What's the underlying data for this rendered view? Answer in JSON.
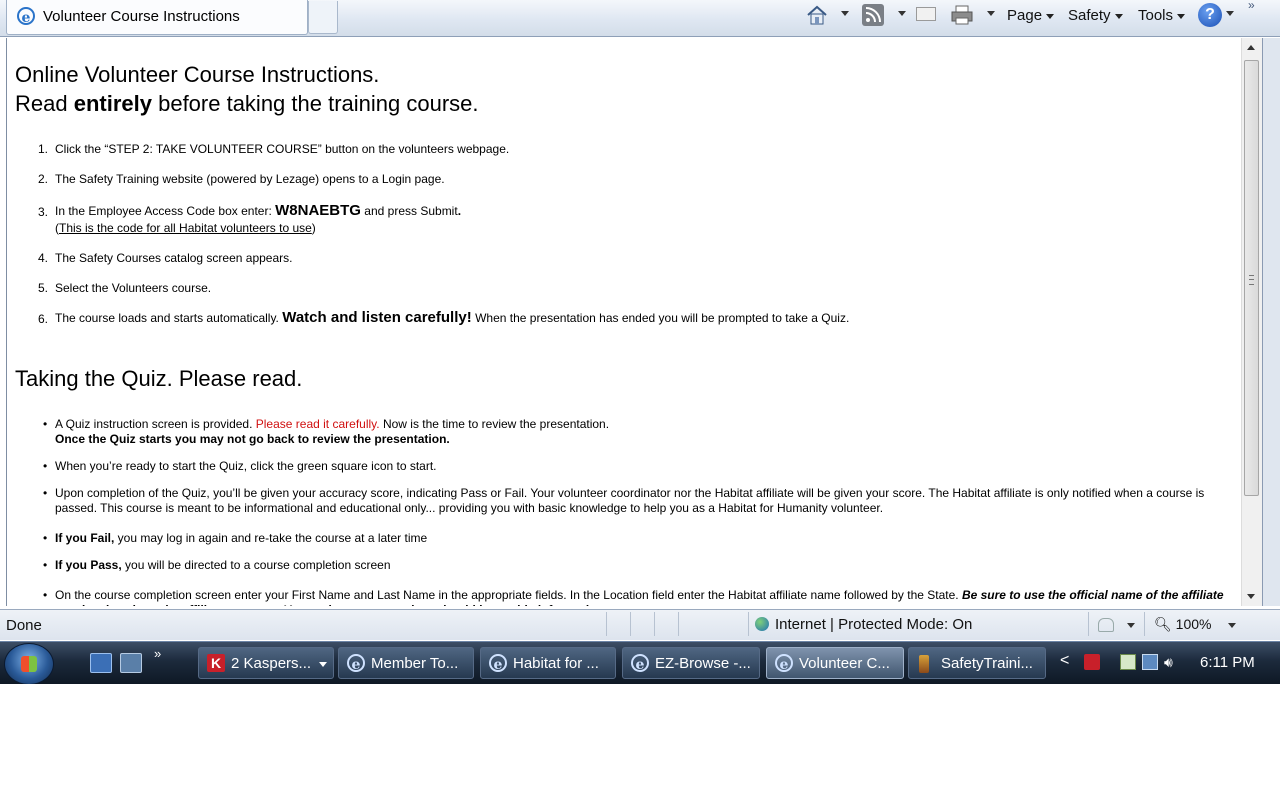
{
  "browser": {
    "tab_title": "Volunteer Course Instructions",
    "commands": [
      "Page",
      "Safety",
      "Tools"
    ]
  },
  "content": {
    "heading1_line1": "Online Volunteer Course Instructions.",
    "heading1_line2_pre": "Read ",
    "heading1_line2_bold": "entirely",
    "heading1_line2_post": " before taking the training course.",
    "steps": [
      {
        "num": "1.",
        "text": "Click the “STEP 2: TAKE VOLUNTEER COURSE” button on the volunteers webpage."
      },
      {
        "num": "2.",
        "text": "The Safety Training website (powered by Lezage) opens to a Login page."
      },
      {
        "num": "3.",
        "pre": "In the Employee Access Code box enter: ",
        "code": "W8NAEBTG",
        "post": " and press Submit",
        "dot": ".",
        "note_open": "(",
        "note": "This is the code for all Habitat volunteers to use",
        "note_close": ")"
      },
      {
        "num": "4.",
        "text": "The Safety Courses catalog screen appears."
      },
      {
        "num": "5.",
        "text": "Select the Volunteers course."
      },
      {
        "num": "6.",
        "pre": "The course loads and starts automatically. ",
        "bold": "Watch and listen carefully!",
        "post": " When the presentation has ended you will be prompted to take a Quiz."
      }
    ],
    "heading2": "Taking the Quiz. Please read.",
    "bullets": [
      {
        "pre": "A Quiz instruction screen is provided. ",
        "red": "Please read it carefully.",
        "post": " Now is the time to review the presentation.",
        "line2": "Once the Quiz starts you may not go back to review the presentation."
      },
      {
        "text": "When you’re ready to start the Quiz, click the green square icon to start."
      },
      {
        "text": "Upon completion of the Quiz, you’ll be given your accuracy score, indicating Pass or Fail. Your volunteer coordinator nor the Habitat affiliate will be given your score. The Habitat affiliate is only notified when a course is passed. This course is meant to be informational and educational only... providing you with basic knowledge to help you as a Habitat for Humanity volunteer."
      },
      {
        "bold": "If you Fail,",
        "post": " you may log in again and re-take the course at a later time"
      },
      {
        "bold": "If you Pass,",
        "post": " you will be directed to a course completion screen"
      },
      {
        "pre": "On the course completion screen enter your First Name and Last Name in the appropriate fields. In the Location field enter the Habitat affiliate name followed by the State. ",
        "bolditalic": "Be sure to use the official name of the affiliate not the city where the affiliate operates. Your volunteer supervisor should know this information."
      }
    ]
  },
  "statusbar": {
    "status": "Done",
    "zone": "Internet | Protected Mode: On",
    "zoom": "100%"
  },
  "taskbar": {
    "buttons": [
      {
        "label": "2 Kaspers...",
        "icon": "kaspersky-icon"
      },
      {
        "label": "Member To...",
        "icon": "ie-icon"
      },
      {
        "label": "Habitat for ...",
        "icon": "ie-icon"
      },
      {
        "label": "EZ-Browse -...",
        "icon": "ie-icon"
      },
      {
        "label": "Volunteer C...",
        "icon": "ie-icon",
        "active": true
      },
      {
        "label": "SafetyTraini...",
        "icon": "app-icon"
      }
    ],
    "clock": "6:11 PM"
  }
}
